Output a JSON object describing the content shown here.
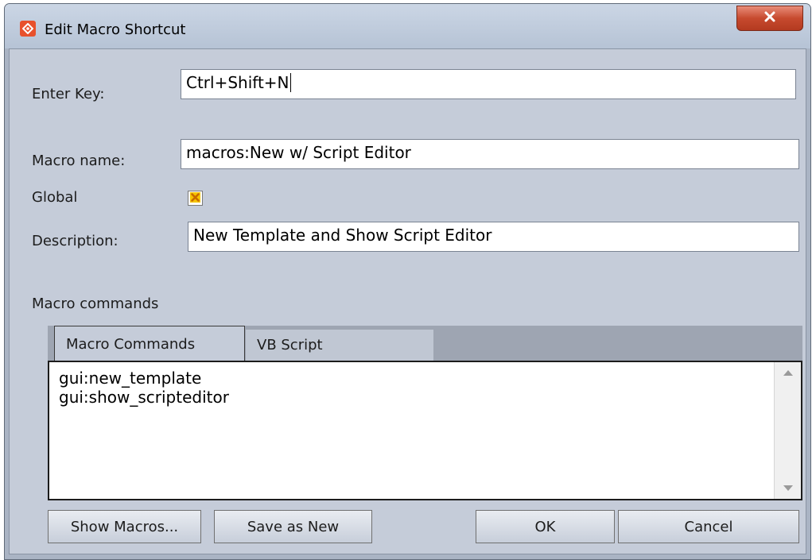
{
  "window": {
    "title": "Edit Macro Shortcut"
  },
  "form": {
    "enter_key_label": "Enter Key:",
    "enter_key_value": "Ctrl+Shift+N",
    "macro_name_label": "Macro name:",
    "macro_name_value": "macros:New w/ Script Editor",
    "global_label": "Global",
    "global_checked": true,
    "description_label": "Description:",
    "description_value": "New Template and Show Script Editor"
  },
  "commands": {
    "section_label": "Macro commands",
    "tabs": [
      {
        "label": "Macro Commands",
        "active": true
      },
      {
        "label": "VB Script",
        "active": false
      }
    ],
    "lines": [
      "gui:new_template",
      "gui:show_scripteditor"
    ]
  },
  "buttons": {
    "show_macros": "Show Macros...",
    "save_as_new": "Save as New",
    "ok": "OK",
    "cancel": "Cancel"
  },
  "icons": {
    "app": "app-logo-icon",
    "close": "close-icon",
    "check": "check-mark-icon"
  },
  "colors": {
    "accent": "#e8512c",
    "check": "#e8a000"
  }
}
